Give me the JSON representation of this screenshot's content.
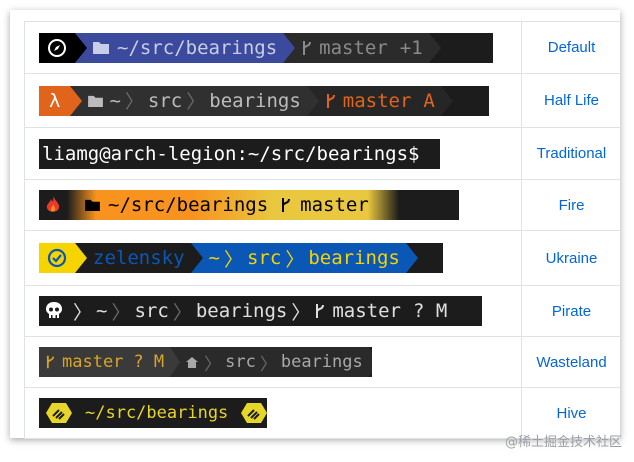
{
  "themes": [
    {
      "name": "Default",
      "prompt": {
        "path": "~/src/bearings",
        "branch": "master",
        "status": "+1"
      },
      "icons": [
        "compass-icon",
        "folder-icon",
        "git-branch-icon"
      ]
    },
    {
      "name": "Half Life",
      "prompt": {
        "lambda": "λ",
        "home": "~",
        "dir1": "src",
        "dir2": "bearings",
        "branch": "master",
        "status": "A"
      },
      "icons": [
        "lambda-icon",
        "folder-icon",
        "git-branch-icon"
      ]
    },
    {
      "name": "Traditional",
      "prompt": {
        "text": "liamg@arch-legion:~/src/bearings$"
      }
    },
    {
      "name": "Fire",
      "prompt": {
        "path": "~/src/bearings",
        "branch": "master"
      },
      "icons": [
        "flame-icon",
        "folder-icon",
        "git-branch-icon"
      ]
    },
    {
      "name": "Ukraine",
      "prompt": {
        "user": "zelensky",
        "home": "~",
        "dir1": "src",
        "dir2": "bearings"
      },
      "icons": [
        "check-circle-icon"
      ]
    },
    {
      "name": "Pirate",
      "prompt": {
        "home": "~",
        "dir1": "src",
        "dir2": "bearings",
        "branch": "master",
        "status": "? M"
      },
      "icons": [
        "skull-icon",
        "git-branch-icon"
      ]
    },
    {
      "name": "Wasteland",
      "prompt": {
        "branch": "master",
        "status": "? M",
        "dir1": "src",
        "dir2": "bearings"
      },
      "icons": [
        "git-branch-icon",
        "home-icon"
      ]
    },
    {
      "name": "Hive",
      "prompt": {
        "path": "~/src/bearings"
      },
      "icons": [
        "bee-hexagon-icon"
      ]
    }
  ],
  "watermark": "@稀土掘金技术社区",
  "colors": {
    "link": "#0366d6",
    "default_blue": "#3b4a9c",
    "halflife_orange": "#e0641c",
    "fire_orange": "#f7931e",
    "ukraine_yellow": "#f5d400",
    "ukraine_blue": "#0a57b6",
    "hive_yellow": "#e6d629"
  }
}
